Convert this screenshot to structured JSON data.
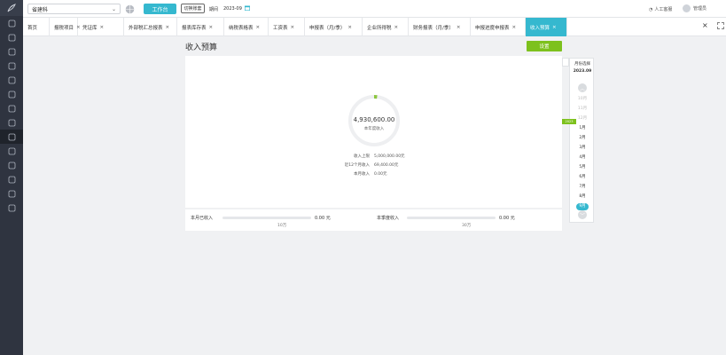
{
  "header": {
    "company_name": "省建科",
    "primary_button": "工作台",
    "outline_button": "切换账套",
    "period_label": "期间",
    "period_value": "2023-09",
    "help_text": "人工客服",
    "user_name": "管理员"
  },
  "tabs": [
    {
      "label": "首页",
      "closable": false
    },
    {
      "label": "报税项目",
      "closable": true
    },
    {
      "label": "凭证库",
      "closable": true
    },
    {
      "label": "外部税汇总报表",
      "closable": true
    },
    {
      "label": "报表库存表",
      "closable": true
    },
    {
      "label": "纳税表格表",
      "closable": true
    },
    {
      "label": "工资表",
      "closable": true
    },
    {
      "label": "申报表（月/季）",
      "closable": true
    },
    {
      "label": "企业所得税",
      "closable": true
    },
    {
      "label": "财务报表（月/季）",
      "closable": true
    },
    {
      "label": "申报进度申报表",
      "closable": true
    },
    {
      "label": "收入预算",
      "closable": true,
      "active": true
    }
  ],
  "main": {
    "title": "收入预算",
    "action_button": "设置",
    "donut": {
      "value": "4,930,600.00",
      "caption": "本年度收入",
      "progress_fraction": 0.02
    },
    "stats": [
      {
        "label": "收入上限",
        "value": "5,000,000.00元"
      },
      {
        "label": "近12个月收入",
        "value": "69,400.00元"
      },
      {
        "label": "本月收入",
        "value": "0.00元"
      }
    ],
    "progress": [
      {
        "label": "本月已收入",
        "value": "0.00 元",
        "sub": "10万",
        "fraction": 0.0
      },
      {
        "label": "本季度收入",
        "value": "0.00 元",
        "sub": "30万",
        "fraction": 0.0
      }
    ]
  },
  "picker": {
    "head": "月份选择",
    "year": "2023.09",
    "badge": "2023",
    "months": [
      {
        "label": "10月",
        "state": "dim"
      },
      {
        "label": "11月",
        "state": "dim"
      },
      {
        "label": "12月",
        "state": "dim"
      },
      {
        "label": "1月",
        "state": "normal"
      },
      {
        "label": "2月",
        "state": "normal"
      },
      {
        "label": "3月",
        "state": "normal"
      },
      {
        "label": "4月",
        "state": "normal"
      },
      {
        "label": "5月",
        "state": "normal"
      },
      {
        "label": "6月",
        "state": "normal"
      },
      {
        "label": "7月",
        "state": "normal"
      },
      {
        "label": "8月",
        "state": "normal"
      },
      {
        "label": "9月",
        "state": "selected"
      }
    ]
  },
  "colors": {
    "accent": "#35b8cf",
    "green": "#7dc11d",
    "sidebar": "#2f3440"
  }
}
